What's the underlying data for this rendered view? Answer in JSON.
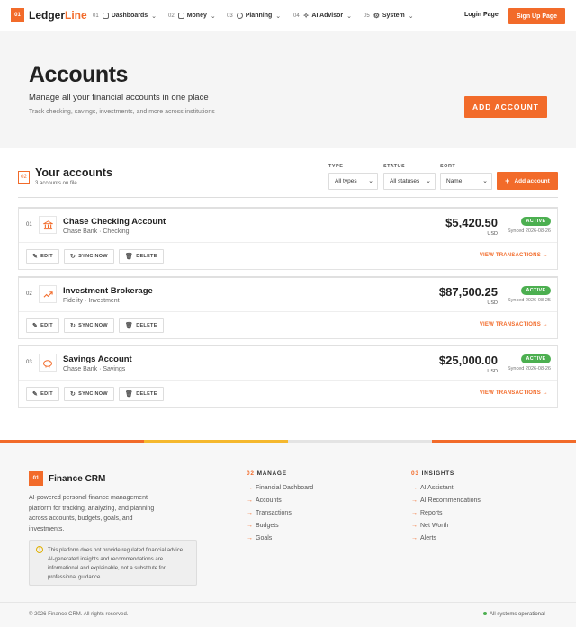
{
  "header": {
    "logo_badge": "01",
    "logo_part1": "Ledger",
    "logo_part2": "Line",
    "nav": [
      {
        "num": "01",
        "label": "Dashboards",
        "icon": "grid-icon"
      },
      {
        "num": "02",
        "label": "Money",
        "icon": "wallet-icon"
      },
      {
        "num": "03",
        "label": "Planning",
        "icon": "globe-icon"
      },
      {
        "num": "04",
        "label": "AI Advisor",
        "icon": "sparkle-icon"
      },
      {
        "num": "05",
        "label": "System",
        "icon": "gear-icon"
      }
    ],
    "login_label": "Login Page",
    "signup_label": "Sign Up Page"
  },
  "hero": {
    "title": "Accounts",
    "subtitle": "Manage all your financial accounts in one place",
    "description": "Track checking, savings, investments, and more across institutions",
    "add_button": "ADD ACCOUNT"
  },
  "section": {
    "num": "02",
    "title": "Your accounts",
    "count_text": "3 accounts on file",
    "filters": {
      "type_label": "TYPE",
      "type_value": "All types",
      "status_label": "STATUS",
      "status_value": "All statuses",
      "sort_label": "SORT",
      "sort_value": "Name"
    },
    "add_button": "Add account"
  },
  "accounts": [
    {
      "idx": "01",
      "name": "Chase Checking Account",
      "meta": "Chase Bank · Checking",
      "balance": "$5,420.50",
      "currency": "USD",
      "status": "ACTIVE",
      "synced": "Synced 2026-08-26",
      "icon": "bank-icon"
    },
    {
      "idx": "02",
      "name": "Investment Brokerage",
      "meta": "Fidelity · Investment",
      "balance": "$87,500.25",
      "currency": "USD",
      "status": "ACTIVE",
      "synced": "Synced 2026-08-25",
      "icon": "trend-up-icon"
    },
    {
      "idx": "03",
      "name": "Savings Account",
      "meta": "Chase Bank · Savings",
      "balance": "$25,000.00",
      "currency": "USD",
      "status": "ACTIVE",
      "synced": "Synced 2026-08-26",
      "icon": "piggy-bank-icon"
    }
  ],
  "card_actions": {
    "edit": "EDIT",
    "sync": "SYNC NOW",
    "delete": "DELETE",
    "view": "VIEW TRANSACTIONS"
  },
  "footer": {
    "logo_badge": "01",
    "name": "Finance CRM",
    "description": "AI-powered personal finance management platform for tracking, analyzing, and planning across accounts, budgets, goals, and investments.",
    "note": "This platform does not provide regulated financial advice. AI-generated insights and recommendations are informational and explainable, not a substitute for professional guidance.",
    "manage": {
      "num": "02",
      "heading": "MANAGE",
      "links": [
        "Financial Dashboard",
        "Accounts",
        "Transactions",
        "Budgets",
        "Goals"
      ]
    },
    "insights": {
      "num": "03",
      "heading": "INSIGHTS",
      "links": [
        "AI Assistant",
        "AI Recommendations",
        "Reports",
        "Net Worth",
        "Alerts"
      ]
    },
    "copyright": "© 2026 Finance CRM. All rights reserved.",
    "status": "All systems operational"
  },
  "colors": {
    "accent": "#f26b2a",
    "active_badge": "#4caf50",
    "stripe_yellow": "#f5b82e"
  }
}
